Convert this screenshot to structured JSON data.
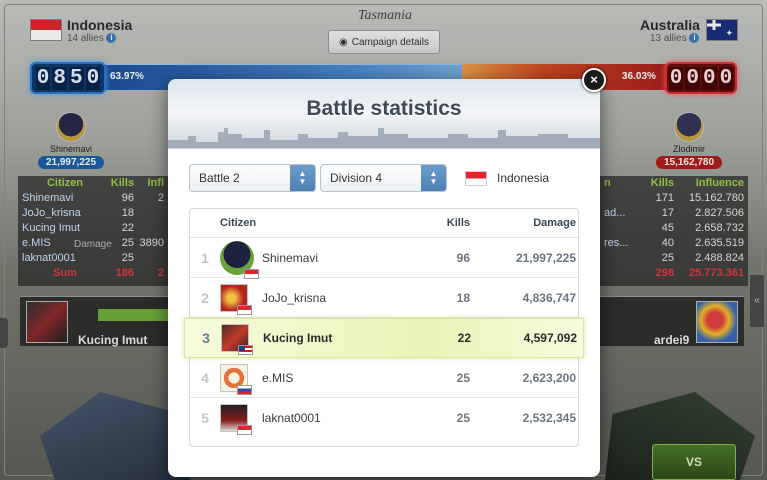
{
  "left_country": {
    "name": "Indonesia",
    "allies": "14 allies"
  },
  "right_country": {
    "name": "Australia",
    "allies": "13 allies"
  },
  "region": "Tasmania",
  "campaign_button": "Campaign details",
  "score": {
    "left_digits": [
      "0",
      "8",
      "5",
      "0"
    ],
    "right_digits": [
      "0",
      "0",
      "0",
      "0"
    ],
    "left_pct": "63.97%",
    "right_pct": "36.03%"
  },
  "heroes": {
    "left": {
      "name": "Shinemavi",
      "damage": "21,997,225"
    },
    "right": {
      "name": "Zlodimir",
      "damage": "15,162,780"
    }
  },
  "left_table": {
    "headers": [
      "Citizen",
      "Kills",
      "Infl"
    ],
    "rows": [
      [
        "Shinemavi",
        "96",
        "2"
      ],
      [
        "JoJo_krisna",
        "18",
        ""
      ],
      [
        "Kucing Imut",
        "22",
        ""
      ],
      [
        "e.MIS",
        "25",
        "3890"
      ],
      [
        "laknat0001",
        "25",
        ""
      ]
    ],
    "sum": [
      "Sum",
      "186",
      "2"
    ],
    "overlay_text": "Damage"
  },
  "right_table": {
    "headers": [
      "n",
      "Kills",
      "Influence"
    ],
    "rows": [
      [
        "",
        "171",
        "15.162.780"
      ],
      [
        "ad...",
        "17",
        "2.827.506"
      ],
      [
        "",
        "45",
        "2.658.732"
      ],
      [
        "res...",
        "40",
        "2.635.519"
      ],
      [
        "",
        "25",
        "2.488.824"
      ]
    ],
    "sum": [
      "",
      "298",
      "25.773.361"
    ]
  },
  "player_bar": {
    "left_name": "Kucing Imut",
    "right_name": "ardei9"
  },
  "vs_label": "VS",
  "modal": {
    "title": "Battle statistics",
    "close_label": "×",
    "battle_select": "Battle 2",
    "division_select": "Division 4",
    "country_filter": "Indonesia",
    "columns": {
      "citizen": "Citizen",
      "kills": "Kills",
      "damage": "Damage"
    },
    "rows": [
      {
        "rank": "1",
        "name": "Shinemavi",
        "kills": "96",
        "damage": "21,997,225",
        "flag": "id",
        "avatar": "a1",
        "highlight": false
      },
      {
        "rank": "2",
        "name": "JoJo_krisna",
        "kills": "18",
        "damage": "4,836,747",
        "flag": "id",
        "avatar": "a2",
        "highlight": false
      },
      {
        "rank": "3",
        "name": "Kucing Imut",
        "kills": "22",
        "damage": "4,597,092",
        "flag": "us",
        "avatar": "a3",
        "highlight": true
      },
      {
        "rank": "4",
        "name": "e.MIS",
        "kills": "25",
        "damage": "2,623,200",
        "flag": "ru",
        "avatar": "a4",
        "highlight": false
      },
      {
        "rank": "5",
        "name": "laknat0001",
        "kills": "25",
        "damage": "2,532,345",
        "flag": "id",
        "avatar": "a5",
        "highlight": false
      }
    ]
  },
  "icons": {
    "info": "info-icon",
    "close": "close-icon",
    "select_arrows": "up-down-arrows-icon",
    "campaign": "globe-icon"
  },
  "colors": {
    "blue_side": "#2f79c9",
    "red_side": "#d33333",
    "highlight_row": "#eaf5b8",
    "select_button": "#4f80b5"
  }
}
